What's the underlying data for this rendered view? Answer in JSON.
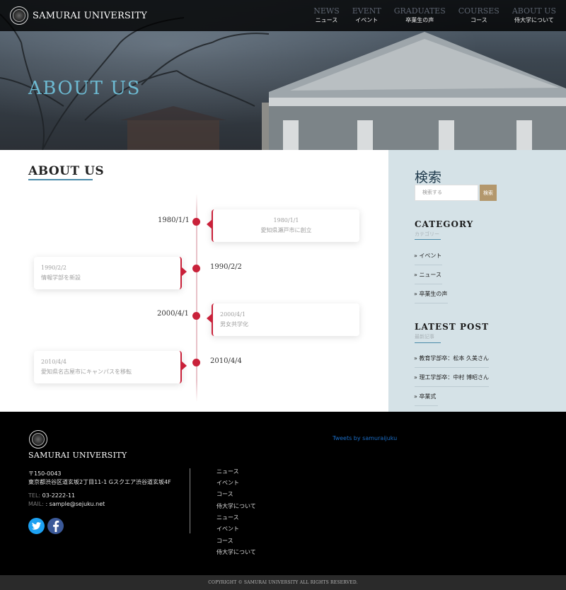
{
  "header": {
    "logo_text": "SAMURAI UNIVERSITY",
    "nav": [
      {
        "en": "NEWS",
        "jp": "ニュース"
      },
      {
        "en": "EVENT",
        "jp": "イベント"
      },
      {
        "en": "GRADUATES",
        "jp": "卒業生の声"
      },
      {
        "en": "COURSES",
        "jp": "コース"
      },
      {
        "en": "ABOUT US",
        "jp": "侍大学について"
      }
    ]
  },
  "hero": {
    "title": "ABOUT US"
  },
  "main": {
    "section_title": "ABOUT US",
    "timeline": [
      {
        "date": "1980/1/1",
        "card_date": "1980/1/1",
        "text": "愛知県瀬戸市に創立"
      },
      {
        "date": "1990/2/2",
        "card_date": "1990/2/2",
        "text": "情報学部を新設"
      },
      {
        "date": "2000/4/1",
        "card_date": "2000/4/1",
        "text": "男女共学化"
      },
      {
        "date": "2010/4/4",
        "card_date": "2010/4/4",
        "text": "愛知県名古屋市にキャンパスを移転"
      }
    ]
  },
  "sidebar": {
    "search_title": "検索",
    "search_placeholder": "検索する",
    "search_button": "検索",
    "category_title": "CATEGORY",
    "category_sub": "カテゴリー",
    "categories": [
      "» イベント",
      "» ニュース",
      "» 卒業生の声"
    ],
    "latest_title": "LATEST POST",
    "latest_sub": "最新記事",
    "latest_posts": [
      "» 教育学部卒：松本 久美さん",
      "» 理工学部卒：中村 博昭さん",
      "» 卒業式"
    ]
  },
  "footer": {
    "name": "SAMURAI UNIVERSITY",
    "postal": "〒150-0043",
    "address": "東京都渋谷区道玄坂2丁目11-1 Gスクエア渋谷道玄坂4F",
    "tel_label": "TEL:",
    "tel": "03-2222-11",
    "mail_label": "MAIL:",
    "mail": ": sample@sejuku.net",
    "links": [
      "ニュース",
      "イベント",
      "コース",
      "侍大学について",
      "ニュース",
      "イベント",
      "コース",
      "侍大学について"
    ],
    "tweets": "Tweets by samuraijuku",
    "copyright": "COPYRIGHT © SAMURAI UNIVERSITY ALL RIGHTS RESERVED."
  },
  "colors": {
    "accent_red": "#c9213a",
    "hero_title": "#6dbad2",
    "sidebar_bg": "#d5e2e7",
    "search_button": "#b3976c",
    "twitter": "#1da1f2",
    "facebook": "#3b5998"
  }
}
